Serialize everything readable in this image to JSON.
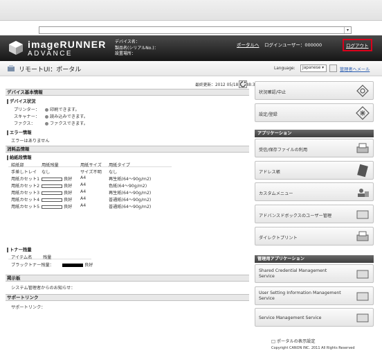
{
  "address": {
    "dropdown_glyph": "▾"
  },
  "header": {
    "brand_line1": "imageRUNNER",
    "brand_line2": "ADVANCE",
    "device_name_label": "デバイス名：",
    "product_name_label": "製品名(シリアルNo.)：",
    "location_label": "設置場所：",
    "portal_link": "ポータルへ",
    "login_user": "ログインユーザー：000000",
    "logout": "ログアウト",
    "logout_highlight_color": "#d9001b"
  },
  "subheader": {
    "title": "リモートUI：ポータル",
    "language_label": "Language:",
    "language_value": "Japanese",
    "admin_link": "管理者へメール"
  },
  "main": {
    "last_updated": "最終更新：2012 05/18 18:48:34",
    "device_basic_info": "デバイス基本情報",
    "device_status": "デバイス状況",
    "status_rows": [
      {
        "label": "プリンター：",
        "value": "印刷できます。"
      },
      {
        "label": "スキャナー：",
        "value": "読み込みできます。"
      },
      {
        "label": "ファクス：",
        "value": "ファクスできます。"
      }
    ],
    "error_info": "エラー情報",
    "error_text": "エラーはありません",
    "consumables": "消耗品情報",
    "paper_info": "給紙段情報",
    "paper_headers": [
      "給紙部",
      "用紙残量",
      "用紙サイズ",
      "用紙タイプ"
    ],
    "paper_rows": [
      {
        "source": "手差しトレイ",
        "remain": "なし",
        "size": "サイズ不明",
        "type": "なし",
        "has_bar": false
      },
      {
        "source": "用紙カセット1",
        "remain": "良好",
        "size": "A4",
        "type": "再生紙(64～90g/m2)",
        "has_bar": true
      },
      {
        "source": "用紙カセット2",
        "remain": "良好",
        "size": "A4",
        "type": "色紙(64～90g/m2)",
        "has_bar": true
      },
      {
        "source": "用紙カセット3",
        "remain": "良好",
        "size": "A4",
        "type": "再生紙(64～90g/m2)",
        "has_bar": true
      },
      {
        "source": "用紙カセット4",
        "remain": "良好",
        "size": "A4",
        "type": "普通紙(64～90g/m2)",
        "has_bar": true
      },
      {
        "source": "用紙カセット5",
        "remain": "良好",
        "size": "A4",
        "type": "普通紙(64～90g/m2)",
        "has_bar": true
      }
    ],
    "toner_info": "トナー残量",
    "toner_headers": [
      "アイテム名",
      "残量"
    ],
    "toner_row": {
      "label": "ブラックトナー残量：",
      "value": "良好"
    },
    "bulletin": "掲示板",
    "bulletin_text": "システム管理者からのお知らせ：",
    "support_link_section": "サポートリンク",
    "support_link_text": "サポートリンク："
  },
  "sidebar": {
    "status_cancel": "状況確認/中止",
    "settings": "設定/登録",
    "applications_head": "アプリケーション",
    "apps": [
      "受信/保存ファイルの利用",
      "アドレス帳",
      "カスタムメニュー",
      "アドバンスドボックスのユーザー管理",
      "ダイレクトプリント"
    ],
    "admin_apps_head": "管理用アプリケーション",
    "admin_apps": [
      "Shared Credential Management Service",
      "User Setting Information Management Service",
      "Service Management Service"
    ],
    "portal_display_settings": "ポータルの表示設定",
    "copyright": "Copyright CANON INC. 2011 All Rights Reserved"
  }
}
